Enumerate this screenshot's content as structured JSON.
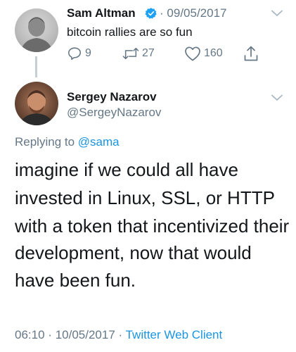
{
  "parent_tweet": {
    "author_name": "Sam Altman",
    "separator": "·",
    "date": "09/05/2017",
    "text": "bitcoin rallies are so fun",
    "actions": {
      "replies": "9",
      "retweets": "27",
      "likes": "160"
    }
  },
  "main_tweet": {
    "author_name": "Sergey Nazarov",
    "handle": "@SergeyNazarov",
    "replying_prefix": "Replying to",
    "replying_to": "@sama",
    "text_lines": [
      "imagine if we could all have",
      "invested in Linux, SSL, or HTTP",
      "with a token that incentivized their",
      "development, now that would",
      "have been fun."
    ],
    "time": "06:10",
    "date": "10/05/2017",
    "separator": "·",
    "client": "Twitter Web Client"
  },
  "colors": {
    "text_primary": "#14171a",
    "text_secondary": "#657786",
    "link": "#1b95e0",
    "verified": "#1da1f2",
    "thread_line": "#c4cfd6"
  },
  "icons": {
    "verified": "verified-badge-icon",
    "menu": "chevron-down-icon",
    "reply": "reply-icon",
    "retweet": "retweet-icon",
    "like": "heart-icon",
    "share": "share-icon"
  }
}
